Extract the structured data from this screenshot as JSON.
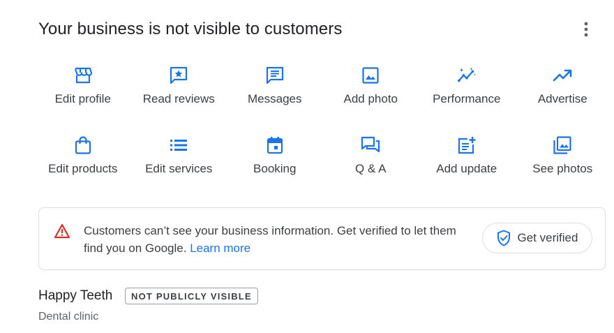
{
  "header": {
    "title": "Your business is not visible to customers",
    "more_icon": "more-vert-icon"
  },
  "actions": [
    {
      "label": "Edit profile",
      "icon": "storefront-icon"
    },
    {
      "label": "Read reviews",
      "icon": "review-star-icon"
    },
    {
      "label": "Messages",
      "icon": "message-icon"
    },
    {
      "label": "Add photo",
      "icon": "photo-icon"
    },
    {
      "label": "Performance",
      "icon": "insights-icon"
    },
    {
      "label": "Advertise",
      "icon": "trending-up-icon"
    },
    {
      "label": "Edit products",
      "icon": "shopping-bag-icon"
    },
    {
      "label": "Edit services",
      "icon": "list-icon"
    },
    {
      "label": "Booking",
      "icon": "calendar-icon"
    },
    {
      "label": "Q & A",
      "icon": "forum-icon"
    },
    {
      "label": "Add update",
      "icon": "post-add-icon"
    },
    {
      "label": "See photos",
      "icon": "photo-library-icon"
    }
  ],
  "alert": {
    "message": "Customers can’t see your business information. Get verified to let them find you on Google.",
    "link_text": "Learn more",
    "button_label": "Get verified",
    "icon": "warning-icon",
    "button_icon": "shield-check-icon"
  },
  "business": {
    "name": "Happy Teeth",
    "badge": "NOT PUBLICLY VISIBLE",
    "category": "Dental clinic"
  },
  "colors": {
    "accent": "#1a73e8",
    "warning": "#d93025",
    "border": "#dadce0"
  }
}
